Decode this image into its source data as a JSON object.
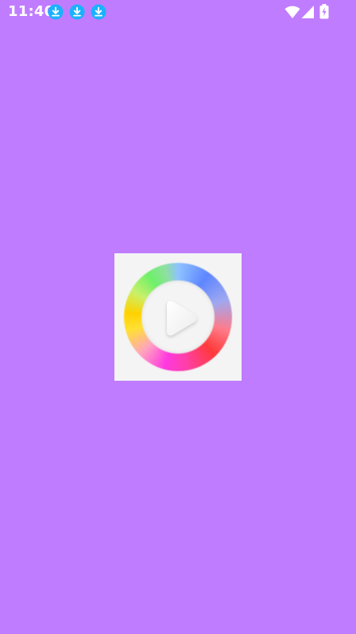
{
  "status_bar": {
    "time": "11:40",
    "notifications": [
      "download-icon",
      "download-icon",
      "download-icon"
    ],
    "system_icons": [
      "wifi-icon",
      "cell-signal-icon",
      "battery-charging-icon"
    ],
    "notification_color": "#1ab2ff"
  },
  "screen": {
    "background_color": "#c07cff"
  },
  "splash": {
    "logo": "color-ring-play-logo",
    "card_color": "#f4f4f4"
  }
}
